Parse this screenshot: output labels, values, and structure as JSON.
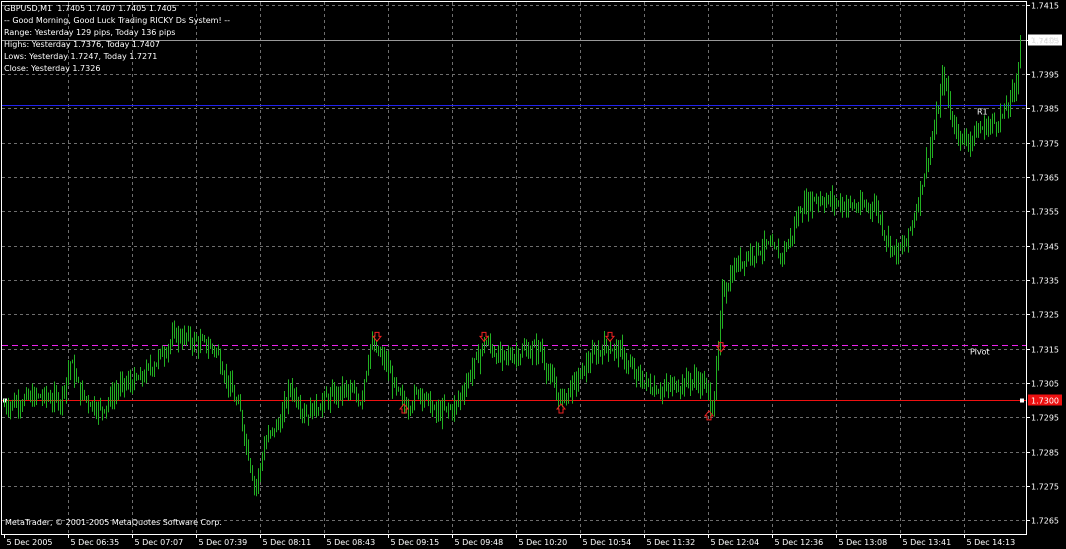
{
  "symbol_header": "GBPUSD,M1  1.7405 1.7407 1.7405 1.7405",
  "info_lines": [
    "-- Good Morning, Good Luck Trading RICKY Ds System! --",
    "Range: Yesterday 129 pips, Today 136 pips",
    "Highs: Yesterday 1.7376, Today 1.7407",
    "Lows: Yesterday 1.7247, Today 1.7271",
    "Close: Yesterday 1.7326"
  ],
  "copyright": "MetaTrader, © 2001-2005 MetaQuotes Software Corp.",
  "colors": {
    "background": "#000000",
    "grid": "#6e6e6e",
    "candles": "#22b022",
    "r1_line": "#2222ee",
    "pivot_line": "#ee22ee",
    "support_line": "#ee1111",
    "current_price_line": "#999999",
    "arrows": "#ee2222",
    "axis_text": "#ffffff"
  },
  "chart_data": {
    "type": "line",
    "series_style": "candlestick",
    "ylim": [
      1.7261,
      1.7416
    ],
    "y_ticks": [
      "1.7265",
      "1.7275",
      "1.7285",
      "1.7295",
      "1.7305",
      "1.7315",
      "1.7325",
      "1.7335",
      "1.7345",
      "1.7355",
      "1.7365",
      "1.7375",
      "1.7385",
      "1.7395",
      "1.7405",
      "1.7415"
    ],
    "x_ticks": [
      "5 Dec 2005",
      "5 Dec 06:35",
      "5 Dec 07:07",
      "5 Dec 07:39",
      "5 Dec 08:11",
      "5 Dec 08:43",
      "5 Dec 09:15",
      "5 Dec 09:48",
      "5 Dec 10:20",
      "5 Dec 10:54",
      "5 Dec 11:32",
      "5 Dec 12:04",
      "5 Dec 12:36",
      "5 Dec 13:08",
      "5 Dec 13:41",
      "5 Dec 14:13"
    ],
    "grid": true,
    "current_price": 1.7405,
    "current_price_label": "1.7405",
    "levels": [
      {
        "label": "R1",
        "value": 1.7386,
        "color": "#2222ee",
        "style": "solid"
      },
      {
        "label": "Pivot",
        "value": 1.7316,
        "color": "#ee22ee",
        "style": "dashed"
      },
      {
        "label": "1.7300",
        "value": 1.73,
        "color": "#ee1111",
        "style": "solid",
        "price_tag": true
      }
    ],
    "price_path": [
      [
        0,
        1.7298
      ],
      [
        20,
        1.73
      ],
      [
        40,
        1.7301
      ],
      [
        60,
        1.73
      ],
      [
        70,
        1.7311
      ],
      [
        80,
        1.7302
      ],
      [
        100,
        1.7297
      ],
      [
        120,
        1.7304
      ],
      [
        140,
        1.7306
      ],
      [
        160,
        1.7313
      ],
      [
        175,
        1.7319
      ],
      [
        195,
        1.7317
      ],
      [
        215,
        1.7315
      ],
      [
        228,
        1.7305
      ],
      [
        240,
        1.7296
      ],
      [
        255,
        1.7274
      ],
      [
        265,
        1.7288
      ],
      [
        280,
        1.7294
      ],
      [
        290,
        1.7304
      ],
      [
        305,
        1.7296
      ],
      [
        325,
        1.73
      ],
      [
        345,
        1.7303
      ],
      [
        360,
        1.73
      ],
      [
        370,
        1.7316
      ],
      [
        385,
        1.7311
      ],
      [
        395,
        1.7303
      ],
      [
        405,
        1.7298
      ],
      [
        420,
        1.7303
      ],
      [
        435,
        1.7296
      ],
      [
        455,
        1.7298
      ],
      [
        470,
        1.7308
      ],
      [
        485,
        1.7317
      ],
      [
        500,
        1.7312
      ],
      [
        520,
        1.7314
      ],
      [
        540,
        1.7315
      ],
      [
        550,
        1.7306
      ],
      [
        560,
        1.73
      ],
      [
        575,
        1.7305
      ],
      [
        590,
        1.7312
      ],
      [
        605,
        1.7316
      ],
      [
        620,
        1.7314
      ],
      [
        635,
        1.7307
      ],
      [
        650,
        1.7304
      ],
      [
        665,
        1.7303
      ],
      [
        680,
        1.7305
      ],
      [
        695,
        1.7306
      ],
      [
        705,
        1.7304
      ],
      [
        712,
        1.7298
      ],
      [
        718,
        1.7314
      ],
      [
        722,
        1.7331
      ],
      [
        735,
        1.7339
      ],
      [
        750,
        1.7343
      ],
      [
        765,
        1.7345
      ],
      [
        780,
        1.7342
      ],
      [
        790,
        1.7347
      ],
      [
        800,
        1.7356
      ],
      [
        815,
        1.7359
      ],
      [
        830,
        1.7358
      ],
      [
        845,
        1.7357
      ],
      [
        860,
        1.7356
      ],
      [
        875,
        1.7357
      ],
      [
        885,
        1.7348
      ],
      [
        895,
        1.7343
      ],
      [
        905,
        1.7345
      ],
      [
        915,
        1.7355
      ],
      [
        925,
        1.7368
      ],
      [
        935,
        1.738
      ],
      [
        943,
        1.7395
      ],
      [
        952,
        1.7381
      ],
      [
        965,
        1.7375
      ],
      [
        980,
        1.7379
      ],
      [
        995,
        1.7381
      ],
      [
        1005,
        1.7384
      ],
      [
        1015,
        1.7391
      ],
      [
        1021,
        1.7407
      ]
    ],
    "arrows": [
      {
        "x": 377,
        "dir": "down",
        "price": 1.7318
      },
      {
        "x": 404,
        "dir": "up",
        "price": 1.7298
      },
      {
        "x": 484,
        "dir": "down",
        "price": 1.7318
      },
      {
        "x": 561,
        "dir": "up",
        "price": 1.7298
      },
      {
        "x": 610,
        "dir": "down",
        "price": 1.7318
      },
      {
        "x": 709,
        "dir": "up",
        "price": 1.7296
      },
      {
        "x": 721,
        "dir": "down",
        "price": 1.7315
      }
    ]
  }
}
